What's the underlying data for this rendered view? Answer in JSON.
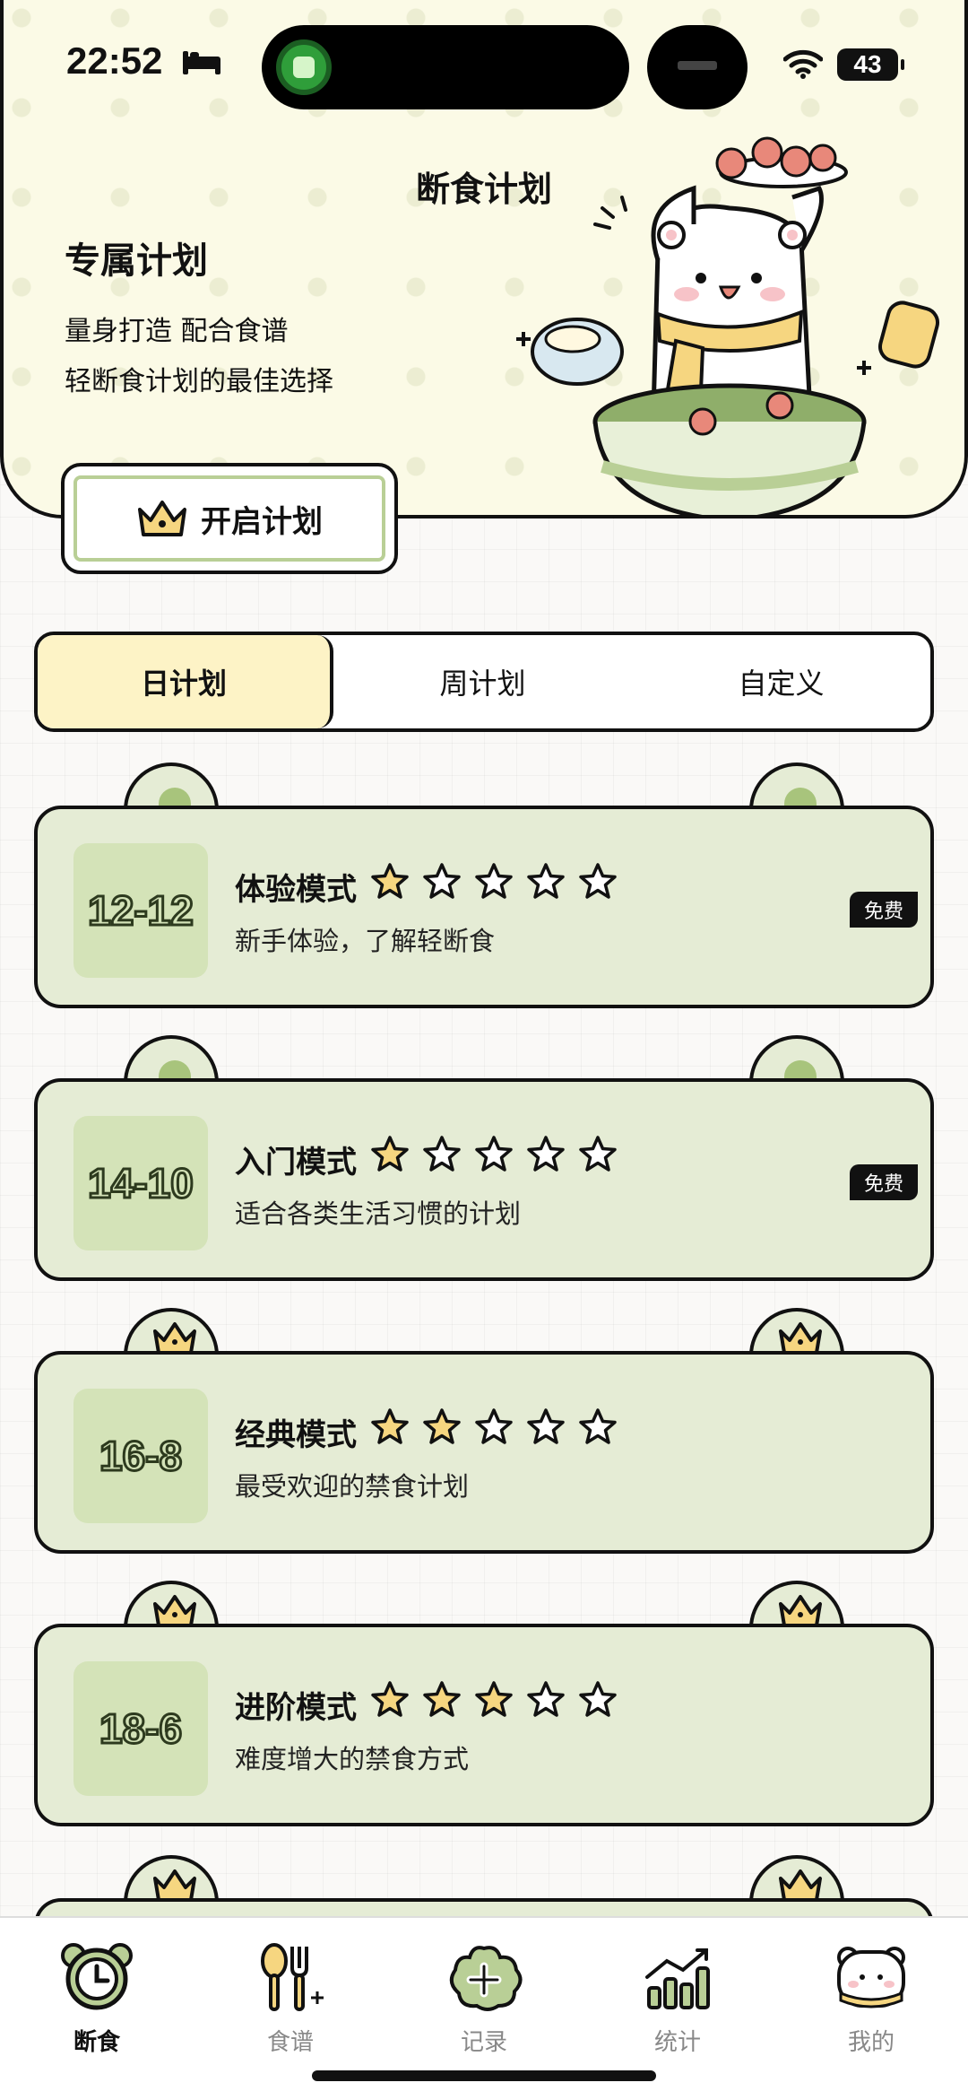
{
  "status_bar": {
    "time": "22:52",
    "battery": "43"
  },
  "hero": {
    "title": "断食计划",
    "subtitle": "专属计划",
    "line1": "量身打造 配合食谱",
    "line2": "轻断食计划的最佳选择",
    "start_button": "开启计划"
  },
  "tabs": [
    {
      "label": "日计划",
      "active": true
    },
    {
      "label": "周计划",
      "active": false
    },
    {
      "label": "自定义",
      "active": false
    }
  ],
  "plans": [
    {
      "ratio": "12-12",
      "name": "体验模式",
      "difficulty": 1,
      "max_stars": 5,
      "desc": "新手体验，了解轻断食",
      "badge": "免费",
      "premium": false
    },
    {
      "ratio": "14-10",
      "name": "入门模式",
      "difficulty": 1,
      "max_stars": 5,
      "desc": "适合各类生活习惯的计划",
      "badge": "免费",
      "premium": false
    },
    {
      "ratio": "16-8",
      "name": "经典模式",
      "difficulty": 2,
      "max_stars": 5,
      "desc": "最受欢迎的禁食计划",
      "badge": "",
      "premium": true
    },
    {
      "ratio": "18-6",
      "name": "进阶模式",
      "difficulty": 3,
      "max_stars": 5,
      "desc": "难度增大的禁食方式",
      "badge": "",
      "premium": true
    }
  ],
  "nav": [
    {
      "label": "断食",
      "icon": "clock-icon",
      "active": true
    },
    {
      "label": "食谱",
      "icon": "utensils-icon",
      "active": false
    },
    {
      "label": "记录",
      "icon": "add-record-icon",
      "active": false
    },
    {
      "label": "统计",
      "icon": "chart-icon",
      "active": false
    },
    {
      "label": "我的",
      "icon": "bear-profile-icon",
      "active": false
    }
  ],
  "colors": {
    "card_bg": "#e5ecd5",
    "ratio_bg": "#d4e3b8",
    "star_fill": "#f6d680",
    "active_tab": "#fdf3c6",
    "hero_bg": "#fbfae6"
  }
}
